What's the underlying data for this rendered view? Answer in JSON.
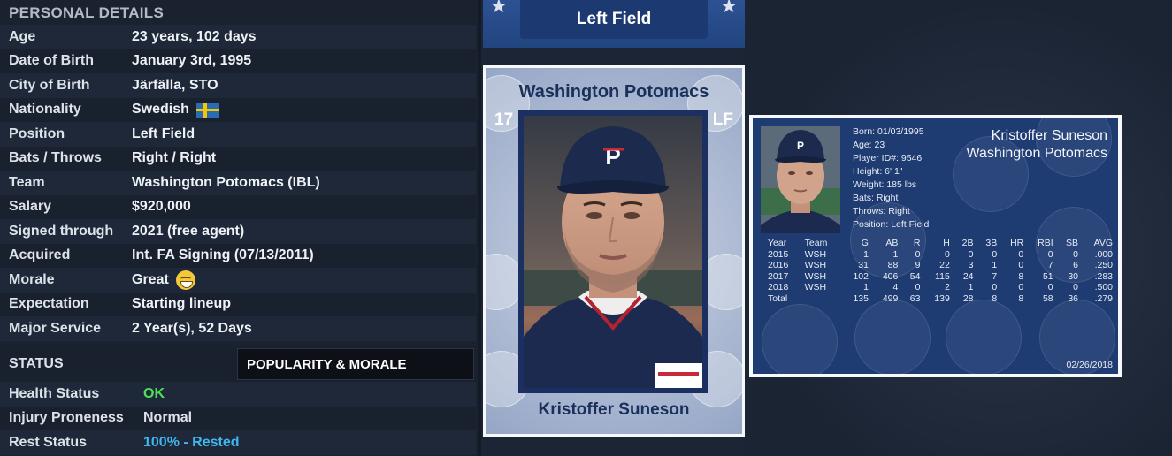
{
  "personal": {
    "title": "PERSONAL DETAILS",
    "rows": [
      {
        "label": "Age",
        "value": "23 years, 102 days"
      },
      {
        "label": "Date of Birth",
        "value": "January 3rd, 1995"
      },
      {
        "label": "City of Birth",
        "value": "Järfälla, STO"
      },
      {
        "label": "Nationality",
        "value": "Swedish"
      },
      {
        "label": "Position",
        "value": "Left Field"
      },
      {
        "label": "Bats / Throws",
        "value": "Right / Right"
      },
      {
        "label": "Team",
        "value": "Washington Potomacs (IBL)"
      },
      {
        "label": "Salary",
        "value": "$920,000"
      },
      {
        "label": "Signed through",
        "value": "2021 (free agent)"
      },
      {
        "label": "Acquired",
        "value": "Int. FA Signing (07/13/2011)"
      },
      {
        "label": "Morale",
        "value": "Great"
      },
      {
        "label": "Expectation",
        "value": "Starting lineup"
      },
      {
        "label": "Major Service",
        "value": "2 Year(s), 52 Days"
      }
    ]
  },
  "status": {
    "title": "STATUS",
    "tab_popularity": "POPULARITY & MORALE",
    "rows": [
      {
        "label": "Health Status",
        "value": "OK"
      },
      {
        "label": "Injury Proneness",
        "value": "Normal"
      },
      {
        "label": "Rest Status",
        "value": "100% - Rested"
      }
    ]
  },
  "banner": {
    "position": "Left Field"
  },
  "card": {
    "team": "Washington Potomacs",
    "number": "17",
    "position": "LF",
    "name": "Kristoffer Suneson"
  },
  "mini_card": {
    "name": "Kristoffer Suneson",
    "team": "Washington Potomacs",
    "info": [
      "Born: 01/03/1995",
      "Age: 23",
      "Player ID#: 9546",
      "Height: 6' 1\"",
      "Weight: 185 lbs",
      "Bats: Right",
      "Throws: Right",
      "Position: Left Field"
    ],
    "stats_headers": [
      "Year",
      "Team",
      "G",
      "AB",
      "R",
      "H",
      "2B",
      "3B",
      "HR",
      "RBI",
      "SB",
      "AVG"
    ],
    "stats_rows": [
      [
        "2015",
        "WSH",
        "1",
        "1",
        "0",
        "0",
        "0",
        "0",
        "0",
        "0",
        "0",
        ".000"
      ],
      [
        "2016",
        "WSH",
        "31",
        "88",
        "9",
        "22",
        "3",
        "1",
        "0",
        "7",
        "6",
        ".250"
      ],
      [
        "2017",
        "WSH",
        "102",
        "406",
        "54",
        "115",
        "24",
        "7",
        "8",
        "51",
        "30",
        ".283"
      ],
      [
        "2018",
        "WSH",
        "1",
        "4",
        "0",
        "2",
        "1",
        "0",
        "0",
        "0",
        "0",
        ".500"
      ],
      [
        "Total",
        "",
        "135",
        "499",
        "63",
        "139",
        "28",
        "8",
        "8",
        "58",
        "36",
        ".279"
      ]
    ],
    "date": "02/26/2018"
  },
  "colors": {
    "ok": "#4fe05a",
    "rested": "#3fb7f0",
    "card_navy": "#1b2f61"
  }
}
